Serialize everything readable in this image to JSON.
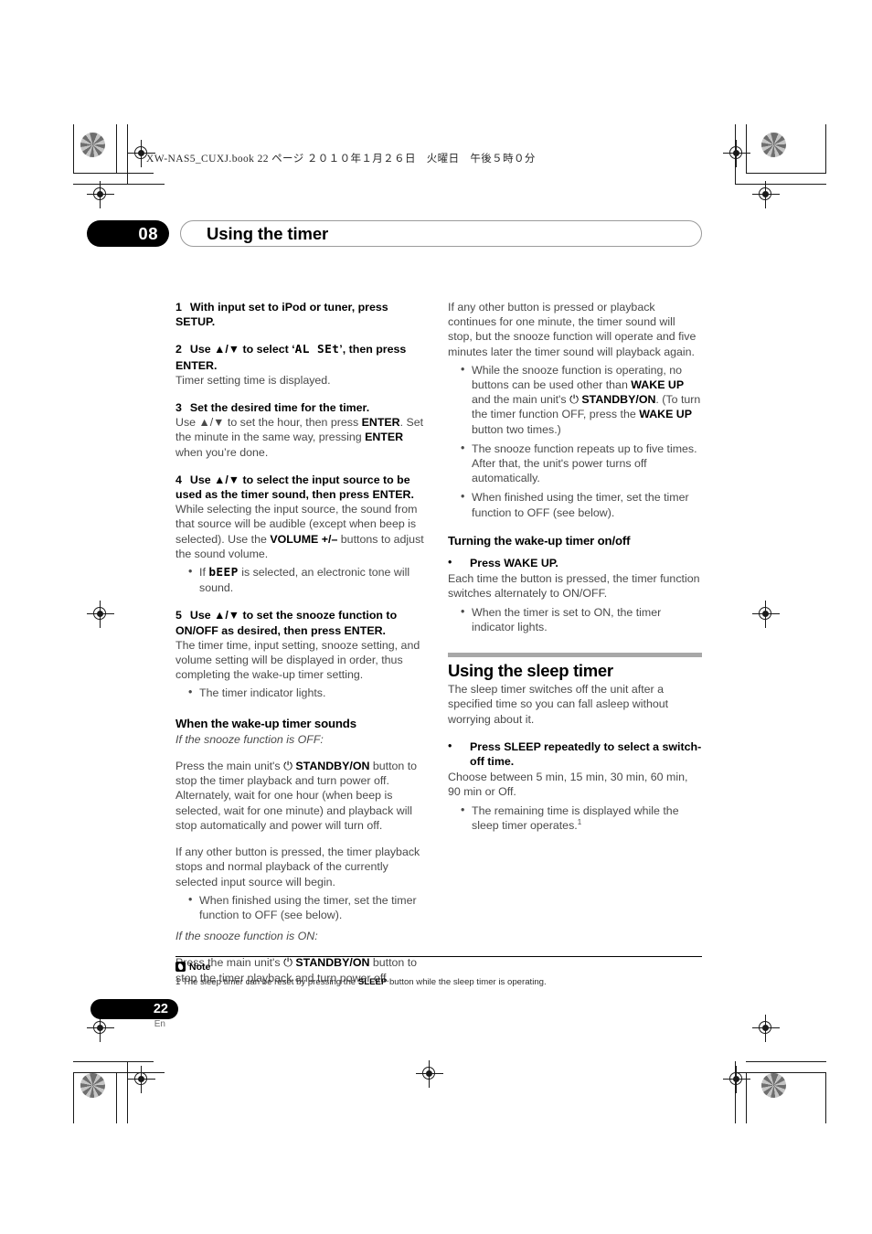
{
  "print_slug": "XW-NAS5_CUXJ.book   22 ページ   ２０１０年１月２６日　火曜日　午後５時０分",
  "header": {
    "chapter_number": "08",
    "chapter_title": "Using the timer"
  },
  "left_column": {
    "step1": {
      "n": "1",
      "text": "With input set to iPod or tuner, press SETUP."
    },
    "step2": {
      "n": "2",
      "pre": "Use ▲/▼ to select ‘",
      "lcd": "AL  SEt",
      "post": "’, then press ENTER.",
      "body": "Timer setting time is displayed."
    },
    "step3": {
      "n": "3",
      "text": "Set the desired time for the timer.",
      "body_a": "Use ▲/▼ to set the hour, then press ",
      "body_a_bold": "ENTER",
      "body_b": ". Set the minute in the same way, pressing ",
      "body_b_bold": "ENTER",
      "body_c": " when you’re done."
    },
    "step4": {
      "n": "4",
      "text": "Use ▲/▼ to select the input source to be used as the timer sound, then press ENTER.",
      "body_a": "While selecting the input source, the sound from that source will be audible (except when beep is selected). Use the ",
      "body_a_bold": "VOLUME +/–",
      "body_b": " buttons to adjust the sound volume.",
      "bullet_pre": "If ",
      "bullet_lcd": "bEEP",
      "bullet_post": " is selected, an electronic tone will sound."
    },
    "step5": {
      "n": "5",
      "text": "Use ▲/▼ to set the snooze function to ON/OFF as desired, then press ENTER.",
      "body": "The timer time, input setting, snooze setting, and volume setting will be displayed in order, thus completing the wake-up timer setting.",
      "bullet": "The timer indicator lights."
    },
    "subheading": "When the wake-up timer sounds",
    "snooze_off_label": "If the snooze function is OFF:",
    "snooze_off_para_a": "Press the main unit's ",
    "snooze_off_power_glyph": "⏻",
    "snooze_off_para_bold": "STANDBY/ON",
    "snooze_off_para_b": " button to stop the timer playback and turn power off. Alternately, wait for one hour (when beep is selected, wait for one minute) and playback will stop automatically and power will turn off.",
    "other_button_para": "If any other button is pressed, the timer playback stops and normal playback of the currently selected input source will begin.",
    "bullet_finished": "When finished using the timer, set the timer function to OFF (see below).",
    "snooze_on_label": "If the snooze function is ON:",
    "snooze_on_para_a": "Press the main unit's ",
    "snooze_on_para_bold": "STANDBY/ON",
    "snooze_on_para_b": " button to stop the timer playback and turn power off."
  },
  "right_column": {
    "intro": "If any other button is pressed or playback continues for one minute, the timer sound will stop, but the snooze function will operate and five minutes later the timer sound will playback again.",
    "bullet1_a": "While the snooze function is operating, no buttons can be used other than ",
    "bullet1_bold1": "WAKE UP",
    "bullet1_b": " and the main unit's ",
    "bullet1_power": "⏻",
    "bullet1_bold2": "STANDBY/ON",
    "bullet1_c": ". (To turn the timer function OFF, press the ",
    "bullet1_bold3": "WAKE UP",
    "bullet1_d": " button two times.)",
    "bullet2": "The snooze function repeats up to five times. After that, the unit's power turns off automatically.",
    "bullet3": "When finished using the timer, set the timer function to OFF (see below).",
    "subheading": "Turning the wake-up timer on/off",
    "press_wake_up": "Press WAKE UP.",
    "wake_body": "Each time the button is pressed, the timer function switches alternately to ON/OFF.",
    "wake_bullet": "When the timer is set to ON, the timer indicator lights.",
    "sleep_heading": "Using the sleep timer",
    "sleep_intro": "The sleep timer switches off the unit after a specified time so you can fall asleep without worrying about it.",
    "sleep_press": "Press SLEEP repeatedly to select a switch-off time.",
    "sleep_choose": "Choose between 5 min, 15 min, 30 min, 60 min, 90 min or Off.",
    "sleep_bullet_a": "The remaining time is displayed while the sleep timer operates.",
    "sleep_bullet_sup": "1"
  },
  "footnote": {
    "label": "Note",
    "marker": "1 ",
    "text_a": "The sleep timer can be reset by pressing the ",
    "bold": "SLEEP",
    "text_b": " button while the sleep timer is operating."
  },
  "footer": {
    "page_number": "22",
    "language": "En"
  },
  "colors": {
    "accent_black": "#000000",
    "rule_gray": "#a8a8a8",
    "body_gray": "#4a4a4a"
  }
}
